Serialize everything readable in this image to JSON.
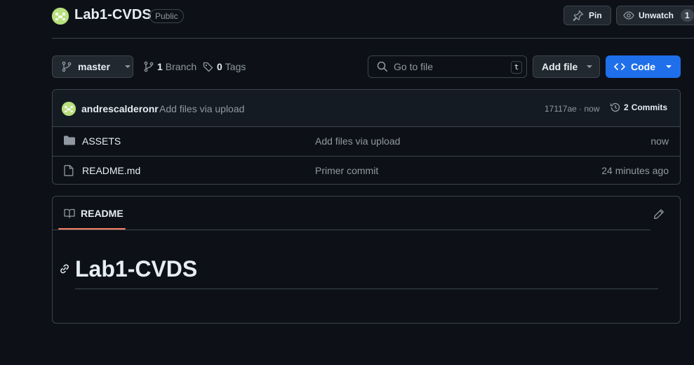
{
  "header": {
    "repo_name": "Lab1-CVDS",
    "visibility": "Public",
    "pin_label": "Pin",
    "watch_label": "Unwatch",
    "watch_count": "1"
  },
  "toolbar": {
    "branch_name": "master",
    "branch_count": "1",
    "branch_label": "Branch",
    "tag_count": "0",
    "tag_label": "Tags",
    "search_placeholder": "Go to file",
    "search_shortcut": "t",
    "add_file_label": "Add file",
    "code_label": "Code"
  },
  "latest_commit": {
    "author": "andrescalderonr",
    "message": "Add files via upload",
    "hash_time": "17117ae · now",
    "commits_count": "2",
    "commits_label": "Commits"
  },
  "files": [
    {
      "name": "ASSETS",
      "type": "folder",
      "message": "Add files via upload",
      "age": "now"
    },
    {
      "name": "README.md",
      "type": "file",
      "message": "Primer commit",
      "age": "24 minutes ago"
    }
  ],
  "readme": {
    "tab_label": "README",
    "heading": "Lab1-CVDS"
  },
  "colors": {
    "background": "#0d1117",
    "border": "#3d444d",
    "accent_blue": "#1f6feb",
    "tab_underline": "#f78166",
    "avatar_green": "#b7e07e"
  },
  "icons": [
    "repo-avatar",
    "pin-icon",
    "eye-icon",
    "branch-icon",
    "tag-icon",
    "search-icon",
    "code-icon",
    "history-icon",
    "folder-icon",
    "file-icon",
    "book-icon",
    "pencil-icon",
    "link-icon"
  ]
}
